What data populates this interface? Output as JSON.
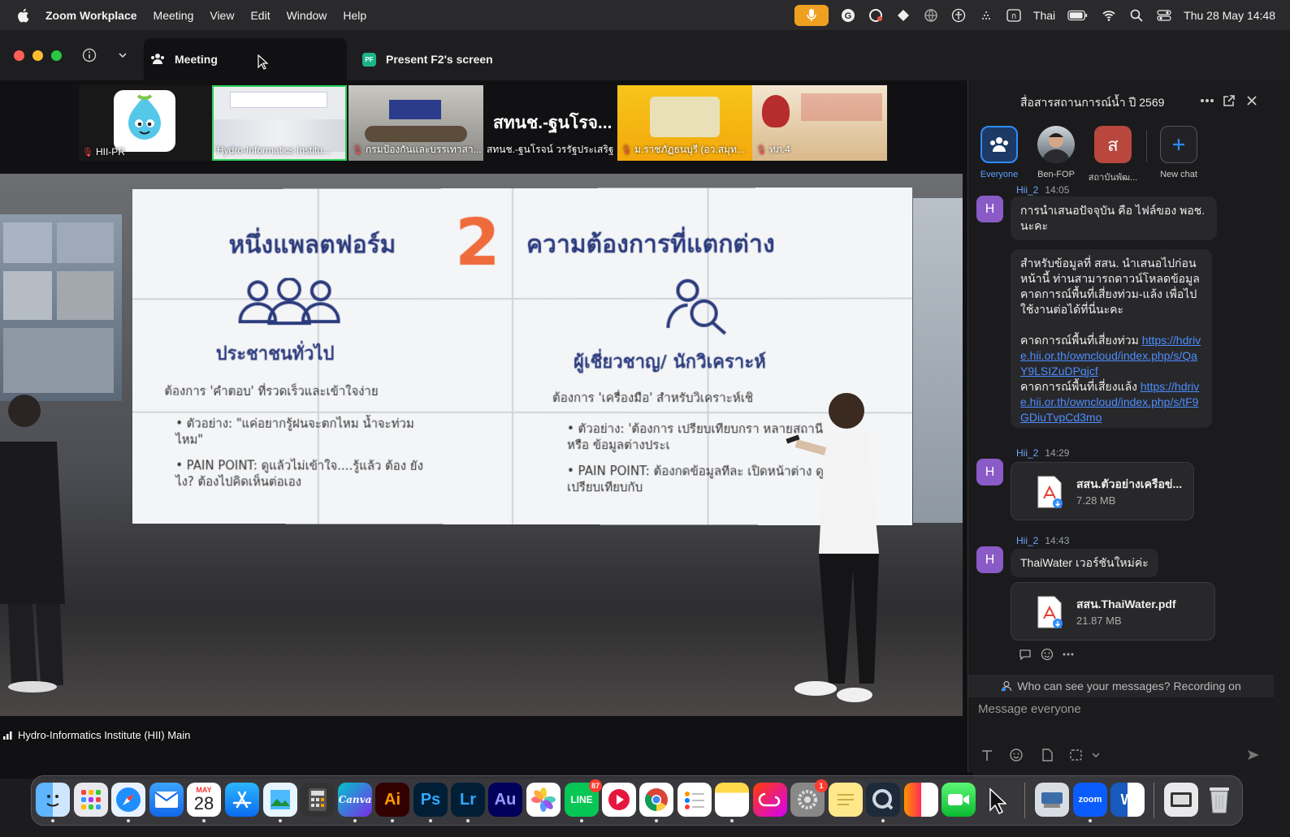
{
  "menubar": {
    "app_name": "Zoom Workplace",
    "items": [
      "Meeting",
      "View",
      "Edit",
      "Window",
      "Help"
    ],
    "input_source": "Thai",
    "clock": "Thu 28 May  14:48"
  },
  "zoom_tabs": {
    "meeting_label": "Meeting",
    "present_badge": "PF",
    "present_label": "Present F2's screen"
  },
  "thumbnails": [
    {
      "label": "HII-PR",
      "muted": true
    },
    {
      "label": "Hydro-Informatics Institu...",
      "muted": false
    },
    {
      "label": "กรมป้องกันและบรรเทาสา...",
      "muted": true
    },
    {
      "label": "สทนช.-ฐนโรจน์ วรรัฐประเสริฐ",
      "muted": false,
      "big_text": "สทนช.-ฐนโรจ..."
    },
    {
      "label": "ม.ราชภัฏธนบุรี (อว.สมุท...",
      "muted": true
    },
    {
      "label": "ทภ.4",
      "muted": true
    }
  ],
  "main_video": {
    "name": "Hydro-Informatics Institute (HII) Main",
    "slide": {
      "title_left": "หนึ่งแพลตฟอร์ม",
      "number": "2",
      "title_right": "ความต้องการที่แตกต่าง",
      "left_heading": "ประชาชนทั่วไป",
      "left_need": "ต้องการ 'คำตอบ' ที่รวดเร็วและเข้าใจง่าย",
      "left_example": "• ตัวอย่าง: \"แค่อยากรู้ฝนจะตกไหม น้ำจะท่วมไหม\"",
      "left_pain": "• PAIN POINT: ดูแล้วไม่เข้าใจ....รู้แล้ว ต้อง ยังไง? ต้องไปคิดเห็นต่อเอง",
      "right_heading": "ผู้เชี่ยวชาญ/ นักวิเคราะห์",
      "right_need": "ต้องการ 'เครื่องมือ' สำหรับวิเคราะห์เชิ",
      "right_example": "• ตัวอย่าง: 'ต้องการ เปรียบเทียบกรา หลายสถานี หรือ ข้อมูลต่างประเ",
      "right_pain": "• PAIN POINT: ต้องกดข้อมูลทีละ เปิดหน้าต่าง ดูเปรียบเทียบกับ"
    }
  },
  "chat": {
    "title": "สื่อสารสถานการณ์น้ำ ปี 2569",
    "contacts": [
      {
        "label": "Everyone",
        "selected": true
      },
      {
        "label": "Ben-FOP",
        "selected": false
      },
      {
        "label": "สถาบันพัฒ...",
        "initial": "ส",
        "selected": false
      },
      {
        "label": "New chat",
        "selected": false
      }
    ],
    "messages": [
      {
        "sender": "Hii_2",
        "time": "14:05",
        "avatar": "H"
      },
      {
        "text1": "การนำเสนอปัจจุบัน คือ ไฟล์ของ พอช. นะคะ"
      },
      {
        "text2": "สำหรับข้อมูลที่ สสน. นำเสนอไปก่อนหน้านี้ ท่านสามารถดาวน์โหลดข้อมูลคาดการณ์พื้นที่เสี่ยงท่วม-แล้ง เพื่อไปใช้งานต่อได้ที่นี่นะคะ"
      },
      {
        "link1_prefix": " คาดการณ์พื้นที่เสี่ยงท่วม ",
        "link1": "https://hdrive.hii.or.th/owncloud/index.php/s/QaY9LSIZuDPqjcf"
      },
      {
        "link2_prefix": "คาดการณ์พื้นที่เสี่ยงแล้ง ",
        "link2": "https://hdrive.hii.or.th/owncloud/index.php/s/tF9GDiuTvpCd3mo"
      }
    ],
    "file_msg1": {
      "sender": "Hii_2",
      "time": "14:29",
      "avatar": "H",
      "file_name": "สสน.ตัวอย่างเครือข่...",
      "file_size": "7.28 MB"
    },
    "file_msg2": {
      "sender": "Hii_2",
      "time": "14:43",
      "avatar": "H",
      "text": "ThaiWater เวอร์ชันใหม่ค่ะ",
      "file_name": "สสน.ThaiWater.pdf",
      "file_size": "21.87 MB"
    },
    "visibility_notice": "Who can see your messages? Recording on",
    "input_placeholder": "Message everyone"
  },
  "dock": {
    "apps": [
      "finder",
      "launchpad",
      "safari",
      "mail",
      "calendar",
      "app-store",
      "preview",
      "calculator",
      "canva",
      "illustrator",
      "photoshop",
      "lightroom",
      "audition",
      "photos",
      "line",
      "screen-recorder",
      "chrome",
      "reminders",
      "notes",
      "creative-cloud",
      "system-settings",
      "stickies",
      "quicktime",
      "pages",
      "facetime",
      "zoom-cursor",
      "keyboard-viewer",
      "zoom",
      "word",
      "screenshot",
      "trash"
    ],
    "calendar_month": "MAY",
    "calendar_day": "28",
    "line_badge": "87",
    "settings_badge": "1"
  },
  "colors": {
    "accent": "#2d8cff",
    "active_speaker": "#2fd05c",
    "mic_active": "#f0a020",
    "chat_avatar": "#8a5bc6"
  }
}
